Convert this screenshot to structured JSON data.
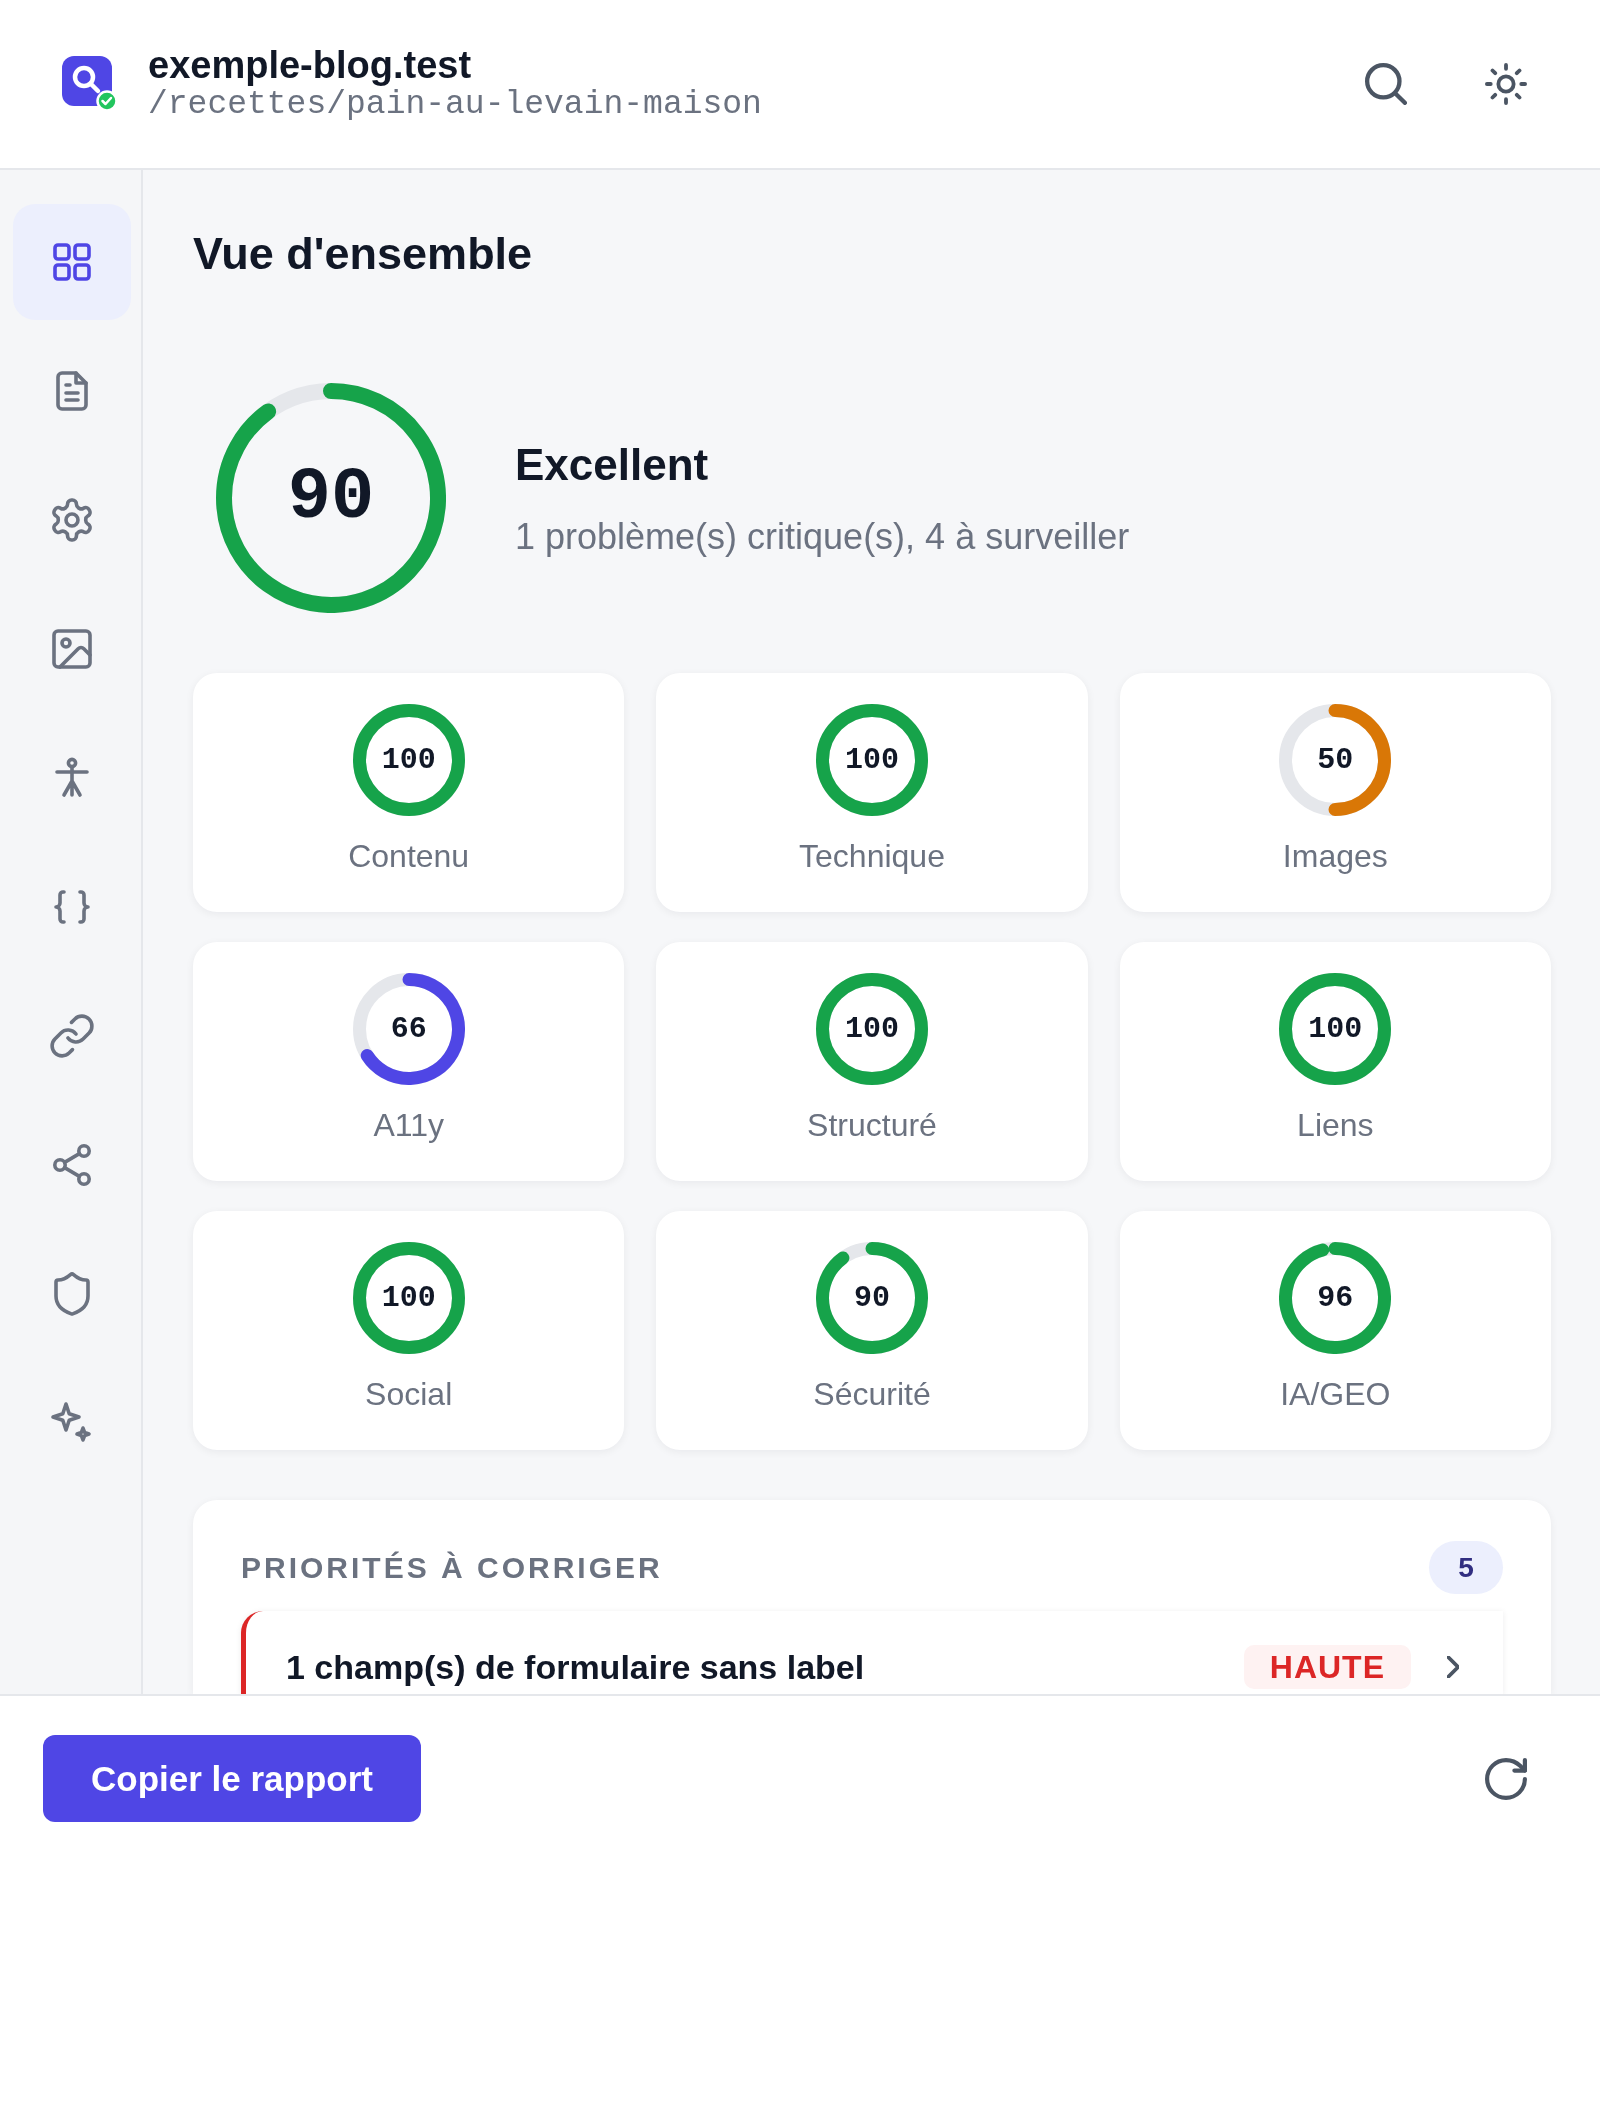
{
  "header": {
    "site": "exemple-blog.test",
    "path": "/recettes/pain-au-levain-maison"
  },
  "sidebar": {
    "items": [
      {
        "selected": true
      },
      {
        "selected": false
      },
      {
        "selected": false
      },
      {
        "selected": false
      },
      {
        "selected": false
      },
      {
        "selected": false
      },
      {
        "selected": false
      },
      {
        "selected": false
      },
      {
        "selected": false
      },
      {
        "selected": false
      }
    ]
  },
  "overview": {
    "title": "Vue d'ensemble",
    "score": "90",
    "rating": "Excellent",
    "summary": "1 problème(s) critique(s), 4 à surveiller"
  },
  "categories": [
    {
      "label": "Contenu",
      "score": "100",
      "color": "#16a34a"
    },
    {
      "label": "Technique",
      "score": "100",
      "color": "#16a34a"
    },
    {
      "label": "Images",
      "score": "50",
      "color": "#d97706"
    },
    {
      "label": "A11y",
      "score": "66",
      "color": "#4f46e5"
    },
    {
      "label": "Structuré",
      "score": "100",
      "color": "#16a34a"
    },
    {
      "label": "Liens",
      "score": "100",
      "color": "#16a34a"
    },
    {
      "label": "Social",
      "score": "100",
      "color": "#16a34a"
    },
    {
      "label": "Sécurité",
      "score": "90",
      "color": "#16a34a"
    },
    {
      "label": "IA/GEO",
      "score": "96",
      "color": "#16a34a"
    }
  ],
  "priorities": {
    "title": "PRIORITÉS À CORRIGER",
    "count": "5",
    "items": [
      {
        "label": "1 champ(s) de formulaire sans label",
        "severity": "HAUTE"
      }
    ]
  },
  "footer": {
    "button": "Copier le rapport"
  }
}
